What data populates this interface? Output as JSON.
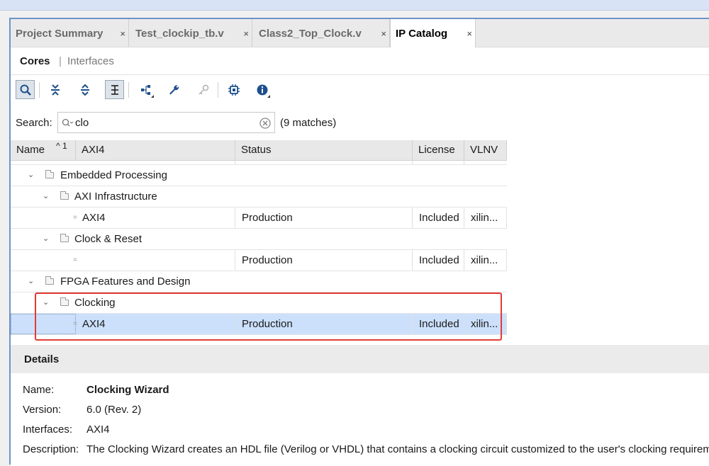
{
  "tabs": [
    {
      "label": "Project Summary",
      "close": "×"
    },
    {
      "label": "Test_clockip_tb.v",
      "close": "×"
    },
    {
      "label": "Class2_Top_Clock.v",
      "close": "×"
    },
    {
      "label": "IP Catalog",
      "close": "×"
    }
  ],
  "subtabs": {
    "cores": "Cores",
    "divider": "|",
    "interfaces": "Interfaces"
  },
  "toolbar_icons": [
    "search-icon",
    "collapse-all-icon",
    "expand-all-icon",
    "hierarchy-toggle-icon",
    "tree-icon",
    "wrench-icon",
    "key-icon",
    "chip-icon",
    "info-icon"
  ],
  "search": {
    "label": "Search:",
    "value": "clo",
    "matches": "(9 matches)"
  },
  "columns": {
    "name": "Name",
    "sort": "^ 1",
    "axi4": "AXI4",
    "status": "Status",
    "license": "License",
    "vlnv": "VLNV"
  },
  "tree": {
    "embedded": "Embedded Processing",
    "axi_infra": "AXI Infrastructure",
    "row1": {
      "axi4": "AXI4",
      "status": "Production",
      "license": "Included",
      "vlnv": "xilin..."
    },
    "clock_reset": "Clock & Reset",
    "row2": {
      "axi4": "",
      "status": "Production",
      "license": "Included",
      "vlnv": "xilin..."
    },
    "fpga": "FPGA Features and Design",
    "clocking": "Clocking",
    "row3": {
      "axi4": "AXI4",
      "status": "Production",
      "license": "Included",
      "vlnv": "xilin..."
    }
  },
  "details": {
    "title": "Details",
    "name_label": "Name:",
    "name_value": "Clocking Wizard",
    "version_label": "Version:",
    "version_value": "6.0 (Rev. 2)",
    "interfaces_label": "Interfaces:",
    "interfaces_value": "AXI4",
    "description_label": "Description:",
    "description_value": "The Clocking Wizard creates an HDL file (Verilog or VHDL) that contains a clocking circuit customized to the user's clocking requiremen"
  },
  "colors": {
    "accent": "#6f93c7",
    "selection": "#cce0fb",
    "highlight": "#e23a35"
  }
}
